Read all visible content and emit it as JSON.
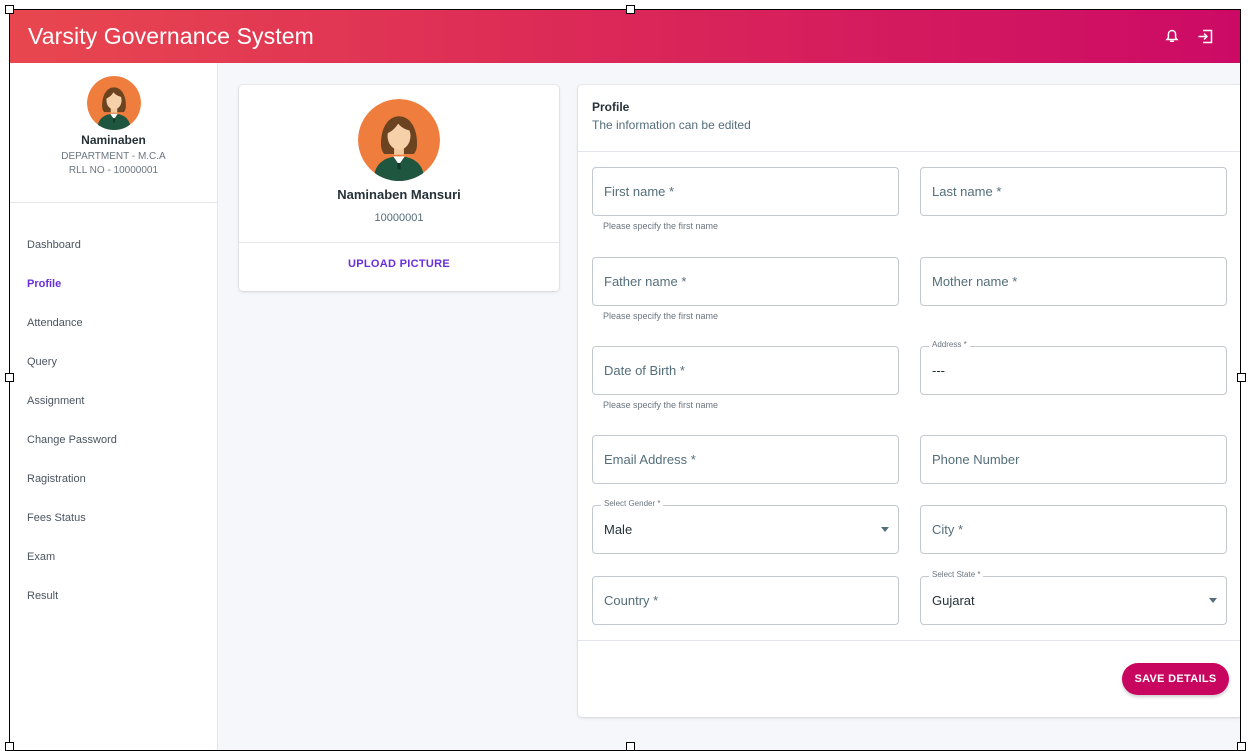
{
  "app": {
    "title": "Varsity Governance System"
  },
  "topbar": {
    "notification_icon": "bell-icon",
    "logout_icon": "logout-icon"
  },
  "sidebar": {
    "user": {
      "name": "Naminaben",
      "department": "DEPARTMENT - M.C.A",
      "roll": "RLL NO - 10000001"
    },
    "items": [
      {
        "label": "Dashboard",
        "active": false
      },
      {
        "label": "Profile",
        "active": true
      },
      {
        "label": "Attendance",
        "active": false
      },
      {
        "label": "Query",
        "active": false
      },
      {
        "label": "Assignment",
        "active": false
      },
      {
        "label": "Change Password",
        "active": false
      },
      {
        "label": "Ragistration",
        "active": false
      },
      {
        "label": "Fees Status",
        "active": false
      },
      {
        "label": "Exam",
        "active": false
      },
      {
        "label": "Result",
        "active": false
      }
    ]
  },
  "profile_card": {
    "name": "Naminaben Mansuri",
    "roll": "10000001",
    "upload_label": "UPLOAD PICTURE"
  },
  "form": {
    "title": "Profile",
    "subtitle": "The information can be edited",
    "first_name": {
      "placeholder": "First name *",
      "helper": "Please specify the first name"
    },
    "last_name": {
      "placeholder": "Last name *"
    },
    "father_name": {
      "placeholder": "Father name *",
      "helper": "Please specify the first name"
    },
    "mother_name": {
      "placeholder": "Mother name *"
    },
    "dob": {
      "placeholder": "Date of Birth *",
      "helper": "Please specify the first name"
    },
    "address": {
      "label": "Address *",
      "value": "---"
    },
    "email": {
      "placeholder": "Email Address *"
    },
    "phone": {
      "placeholder": "Phone Number"
    },
    "gender": {
      "label": "Select Gender *",
      "value": "Male"
    },
    "city": {
      "placeholder": "City *"
    },
    "country": {
      "placeholder": "Country *"
    },
    "state": {
      "label": "Select State *",
      "value": "Gujarat"
    },
    "save_label": "SAVE DETAILS"
  },
  "colors": {
    "accent": "#c8065f",
    "link": "#6a2fd8",
    "header_start": "#e8474f",
    "header_end": "#cc0a66"
  }
}
